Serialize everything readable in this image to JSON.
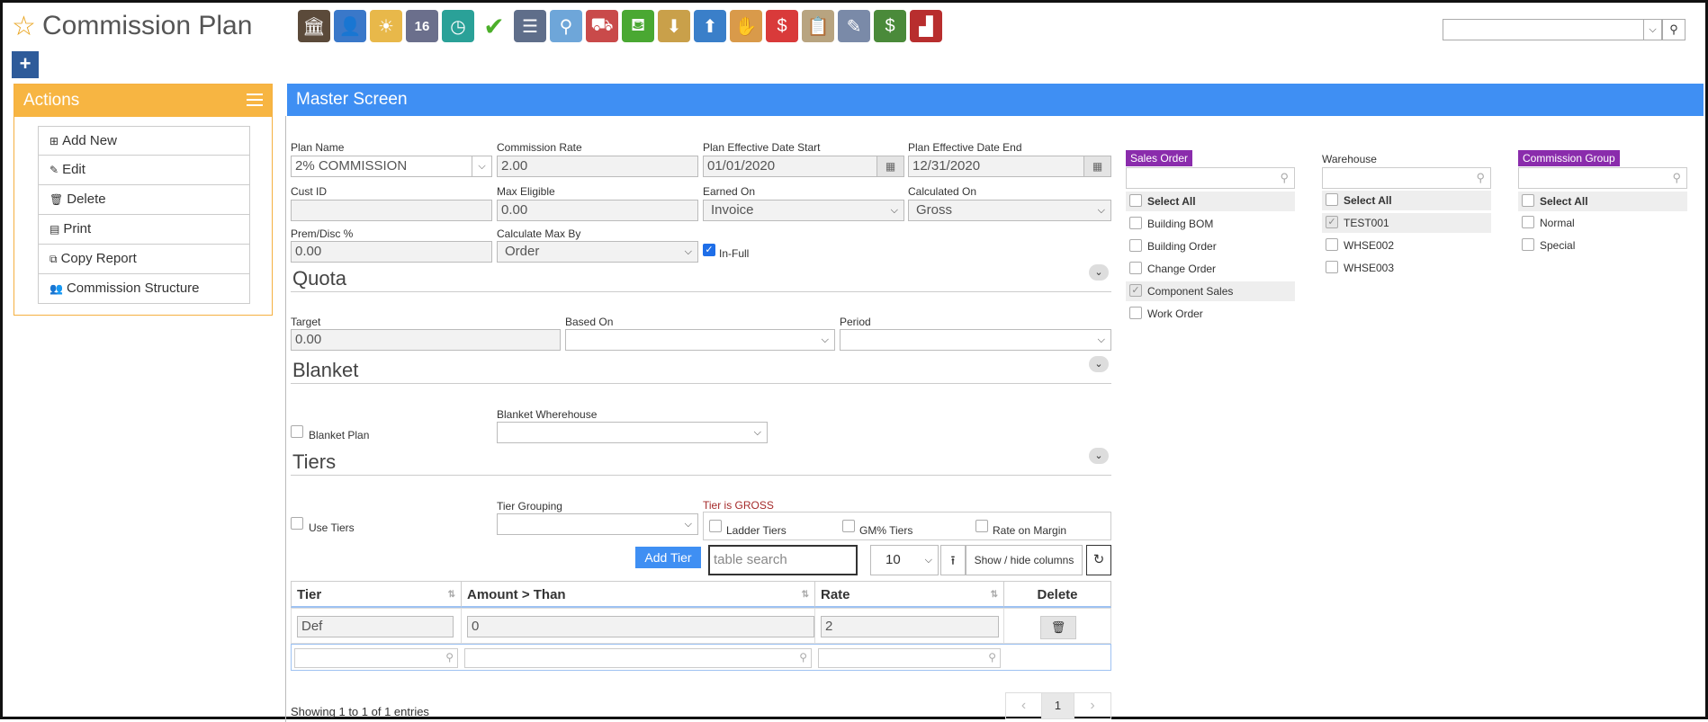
{
  "header": {
    "title": "Commission Plan"
  },
  "toolbar": {
    "icons": [
      "bank-icon",
      "user-icon",
      "weather-icon",
      "calendar-16-icon",
      "clock-icon",
      "checkmark-icon",
      "list-icon",
      "search-magnifier-icon",
      "truck-icon",
      "basket-icon",
      "download-box-icon",
      "upload-box-icon",
      "hand-money-icon",
      "dollar-chat-icon",
      "clipboard-icon",
      "pencil-ruler-icon",
      "cash-icon",
      "factory-icon"
    ],
    "calendar_day": "16"
  },
  "actions": {
    "title": "Actions",
    "items": [
      "Add New",
      "Edit",
      "Delete",
      "Print",
      "Copy Report",
      "Commission Structure"
    ]
  },
  "master": {
    "title": "Master Screen",
    "plan_name_label": "Plan Name",
    "plan_name": "2% COMMISSION",
    "commission_rate_label": "Commission Rate",
    "commission_rate": "2.00",
    "eff_start_label": "Plan Effective Date Start",
    "eff_start": "01/01/2020",
    "eff_end_label": "Plan Effective Date End",
    "eff_end": "12/31/2020",
    "cust_id_label": "Cust ID",
    "cust_id": "",
    "max_eligible_label": "Max Eligible",
    "max_eligible": "0.00",
    "earned_on_label": "Earned On",
    "earned_on": "Invoice",
    "calculated_on_label": "Calculated On",
    "calculated_on": "Gross",
    "prem_disc_label": "Prem/Disc %",
    "prem_disc": "0.00",
    "calc_max_by_label": "Calculate Max By",
    "calc_max_by": "Order",
    "in_full_label": "In-Full"
  },
  "quota": {
    "title": "Quota",
    "target_label": "Target",
    "target": "0.00",
    "based_on_label": "Based On",
    "period_label": "Period"
  },
  "blanket": {
    "title": "Blanket",
    "plan_label": "Blanket Plan",
    "warehouse_label": "Blanket Wherehouse"
  },
  "tiers": {
    "title": "Tiers",
    "use_tiers_label": "Use Tiers",
    "grouping_label": "Tier Grouping",
    "gross_note": "Tier is GROSS",
    "ladder_label": "Ladder Tiers",
    "gm_label": "GM% Tiers",
    "margin_label": "Rate on Margin",
    "add_tier": "Add Tier",
    "table_search_placeholder": "table search",
    "page_size": "10",
    "show_hide": "Show / hide columns",
    "columns": [
      "Tier",
      "Amount > Than",
      "Rate",
      "Delete"
    ],
    "rows": [
      {
        "tier": "Def",
        "amount": "0",
        "rate": "2"
      }
    ],
    "showing": "Showing 1 to 1 of 1 entries",
    "page_prev": "‹",
    "page_current": "1",
    "page_next": "›"
  },
  "sales_order": {
    "title": "Sales Order",
    "items": [
      "Select All",
      "Building BOM",
      "Building Order",
      "Change Order",
      "Component Sales",
      "Work Order"
    ]
  },
  "warehouse": {
    "title": "Warehouse",
    "items": [
      "Select All",
      "TEST001",
      "WHSE002",
      "WHSE003"
    ]
  },
  "commission_group": {
    "title": "Commission Group",
    "items": [
      "Select All",
      "Normal",
      "Special"
    ]
  },
  "colors": {
    "actions": "#f7b542",
    "master": "#3f8ff3",
    "tag": "#8a2cac"
  }
}
